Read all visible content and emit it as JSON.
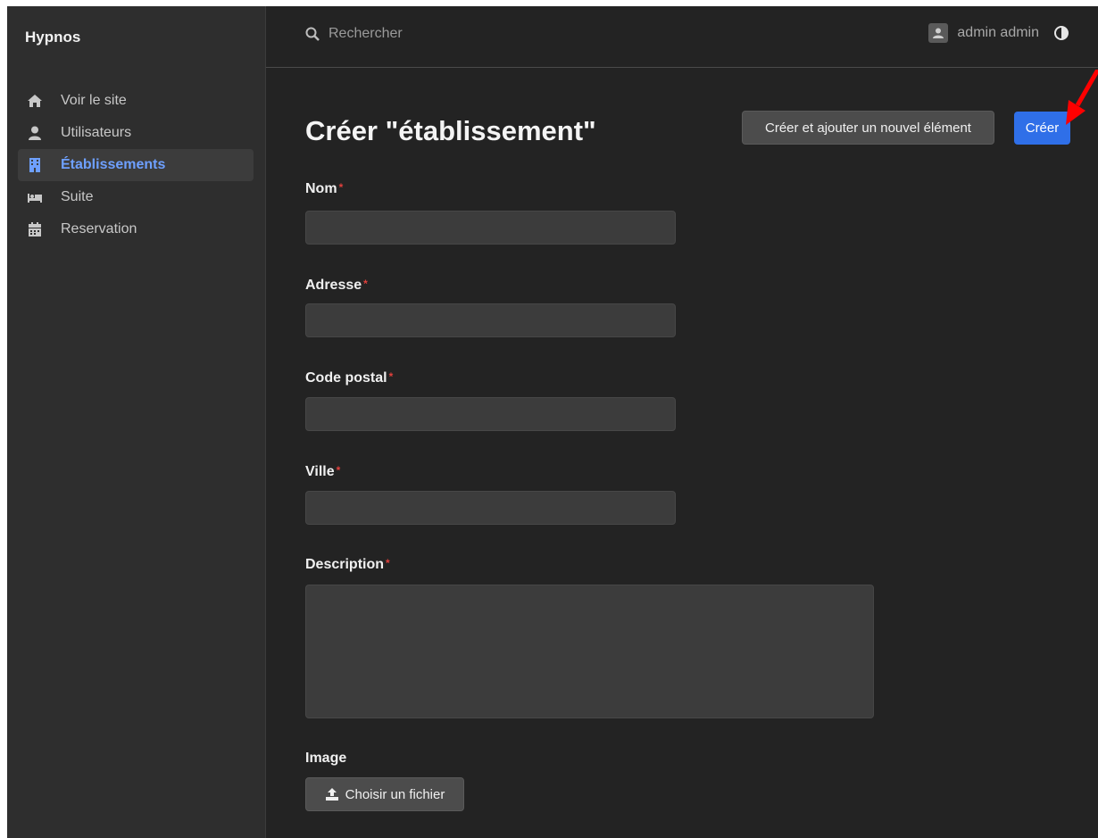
{
  "sidebar": {
    "brand": "Hypnos",
    "items": [
      {
        "label": "Voir le site",
        "icon": "home-icon"
      },
      {
        "label": "Utilisateurs",
        "icon": "user-icon"
      },
      {
        "label": "Établissements",
        "icon": "building-icon"
      },
      {
        "label": "Suite",
        "icon": "bed-icon"
      },
      {
        "label": "Reservation",
        "icon": "calendar-icon"
      }
    ],
    "active_index": 2
  },
  "topbar": {
    "search_placeholder": "Rechercher",
    "user_name": "admin admin",
    "theme_icon": "contrast-icon"
  },
  "page": {
    "title": "Créer \"établissement\"",
    "save_and_add_label": "Créer et ajouter un nouvel élément",
    "create_label": "Créer"
  },
  "form": {
    "nom": {
      "label": "Nom",
      "required": "*",
      "value": ""
    },
    "adresse": {
      "label": "Adresse",
      "required": "*",
      "value": ""
    },
    "code_postal": {
      "label": "Code postal",
      "required": "*",
      "value": ""
    },
    "ville": {
      "label": "Ville",
      "required": "*",
      "value": ""
    },
    "description": {
      "label": "Description",
      "required": "*",
      "value": ""
    },
    "image": {
      "label": "Image",
      "button_label": "Choisir un fichier"
    }
  },
  "colors": {
    "accent": "#2f6fe8",
    "active_nav": "#6ea0ff",
    "required": "#e0403c",
    "annotation_arrow": "#ff0000"
  }
}
